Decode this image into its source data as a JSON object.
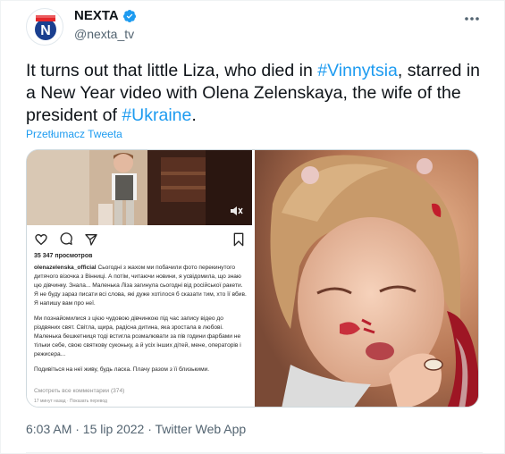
{
  "author": {
    "display_name": "NEXTA",
    "handle": "@nexta_tv",
    "verified": true,
    "logo_letter": "N"
  },
  "tweet": {
    "text_parts": {
      "p1": "It turns out that little Liza, who died in ",
      "hashtag1": "#Vinnytsia",
      "p2": ", starred in a New Year video with Olena Zelenskaya, the wife of the president of ",
      "hashtag2": "#Ukraine",
      "p3": "."
    },
    "translate_label": "Przetłumacz Tweeta",
    "timestamp": "6:03 AM · 15 lip 2022 · Twitter Web App"
  },
  "instagram": {
    "views": "35 347 просмотров",
    "username": "olenazelenska_official",
    "caption1": " Сьогодні з жахом ми побачили фото перекинутого дитячого візочка з Вінниці. А потім, читаючи новини, я усвідомила, що знаю цю дівчинку. Знала... Маленька Ліза загинула сьогодні від російської ракети. Я не буду зараз писати всі слова, які дуже хотілося б сказати тим, хто її вбив. Я напишу вам про неї.",
    "caption2": "Ми познайомилися з цією чудовою дівчинкою під час запису відео до різдвяних свят. Світла, щира, радісна дитина, яка зростала в любові. Маленька бешкетниця тоді встигла розмалювати за пів години фарбами не тільки себе, свою святкову суконьку, а й усіх інших дітей, мене, операторів і режисера...",
    "caption3": "Подивіться на неї живу, будь ласка. Плачу разом з її близькими.",
    "comments_link": "Смотреть все комментарии (374)",
    "meta": "17 минут назад · Показать перевод"
  },
  "colors": {
    "accent": "#1d9bf0",
    "logo_red": "#e4262a",
    "logo_blue": "#1a3f8f",
    "secondary_text": "#536471"
  }
}
